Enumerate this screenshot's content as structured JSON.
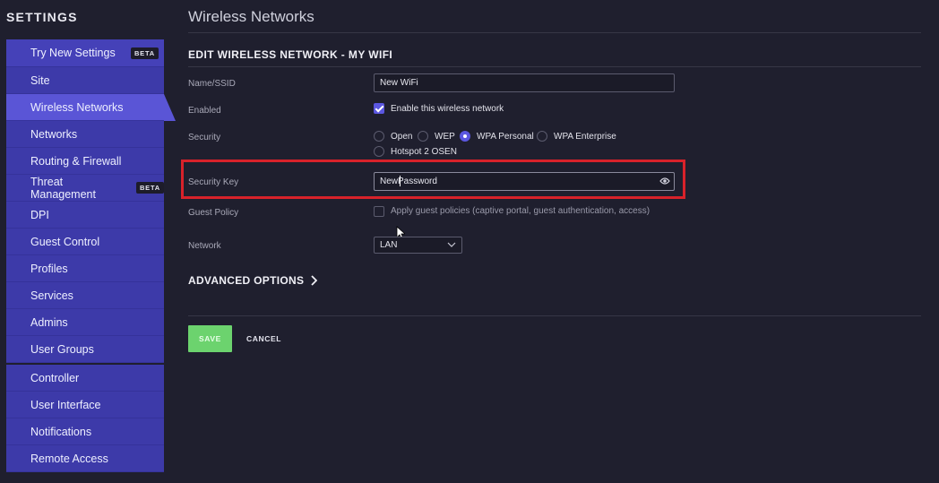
{
  "sidebar": {
    "title": "SETTINGS",
    "group1": [
      {
        "label": "Try New Settings",
        "badge": "BETA"
      },
      {
        "label": "Site"
      },
      {
        "label": "Wireless Networks",
        "active": true
      },
      {
        "label": "Networks"
      },
      {
        "label": "Routing & Firewall"
      },
      {
        "label": "Threat Management",
        "badge": "BETA"
      },
      {
        "label": "DPI"
      },
      {
        "label": "Guest Control"
      },
      {
        "label": "Profiles"
      },
      {
        "label": "Services"
      },
      {
        "label": "Admins"
      },
      {
        "label": "User Groups"
      }
    ],
    "group2": [
      {
        "label": "Controller"
      },
      {
        "label": "User Interface"
      },
      {
        "label": "Notifications"
      },
      {
        "label": "Remote Access"
      }
    ]
  },
  "main": {
    "page_title": "Wireless Networks",
    "section_title": "EDIT WIRELESS NETWORK - MY WIFI",
    "fields": {
      "name_label": "Name/SSID",
      "name_value": "New WiFi",
      "enabled_label": "Enabled",
      "enabled_checkbox_label": "Enable this wireless network",
      "security_label": "Security",
      "security_options": [
        "Open",
        "WEP",
        "WPA Personal",
        "WPA Enterprise",
        "Hotspot 2 OSEN"
      ],
      "security_selected": "WPA Personal",
      "security_key_label": "Security Key",
      "security_key_value": "NewPassword",
      "guest_policy_label": "Guest Policy",
      "guest_policy_checkbox_label": "Apply guest policies (captive portal, guest authentication, access)",
      "network_label": "Network",
      "network_value": "LAN"
    },
    "advanced_options": "ADVANCED OPTIONS",
    "save_label": "SAVE",
    "cancel_label": "CANCEL"
  },
  "colors": {
    "accent": "#5b57e0",
    "sidebar_bg": "#3d3aa9",
    "active_item": "#5a55d6",
    "save_button": "#6cd36e",
    "highlight": "#d8222a",
    "background": "#1f1f2e"
  },
  "icons": [
    "eye-icon",
    "chevron-down-icon",
    "chevron-right-icon",
    "mouse-cursor-icon"
  ]
}
